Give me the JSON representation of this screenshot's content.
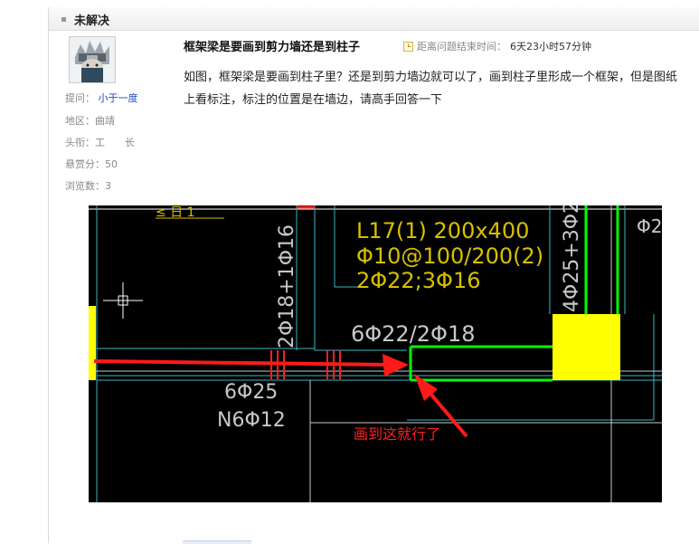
{
  "header": {
    "title": "未解决"
  },
  "question": {
    "title": "框架梁是要画到剪力墙还是到柱子",
    "timer_label": "距离问题结束时间：",
    "timer_value": "6天23小时57分钟",
    "body": "如图，框架梁是要画到柱子里？还是到剪力墙边就可以了，画到柱子里形成一个框架，但是图纸上看标注，标注的位置是在墙边，请高手回答一下"
  },
  "asker": {
    "asker_label": "提问：",
    "asker_name": "小于一度",
    "region": "地区：曲靖",
    "rank": "头衔：工　　长",
    "bounty": "悬赏分：50",
    "views": "浏览数：3"
  },
  "drawing": {
    "beam_label_line1": "L17(1) 200x400",
    "beam_label_line2": "Φ10@100/200(2)",
    "beam_label_line3": "2Φ22;3Φ16",
    "top_bars": "6Φ22/2Φ18",
    "vertical_left": "2Φ18+1Φ16",
    "vertical_right": "4Φ25+3Φ2",
    "bottom_bars": "6Φ25",
    "side_bars": "N6Φ12",
    "annotation": "画到这就行了",
    "top_fragment": "≤ 日 1",
    "top_right_fragment": "Φ2"
  }
}
